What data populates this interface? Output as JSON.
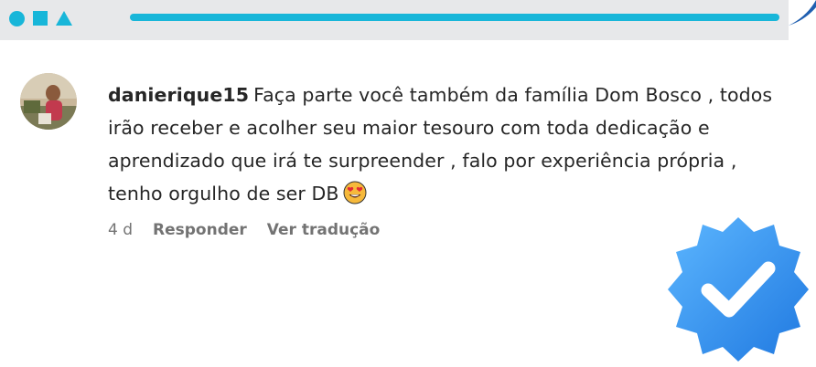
{
  "header": {
    "shapes": [
      "circle-icon",
      "square-icon",
      "triangle-icon"
    ],
    "accent_color": "#18b6d9",
    "band_color": "#e7e8ea"
  },
  "comment": {
    "username": "danierique15",
    "text": "Faça parte você também da família Dom Bosco , todos irão receber e acolher seu maior tesouro com toda dedicação e aprendizado que irá te surpreender , falo por experiência própria , tenho orgulho de ser DB",
    "emoji": "smiling-face-with-heart-eyes-icon",
    "time": "4 d",
    "reply_label": "Responder",
    "translate_label": "Ver tradução"
  },
  "badge": {
    "icon": "verified-badge-icon",
    "color": "#2a8ff0"
  }
}
